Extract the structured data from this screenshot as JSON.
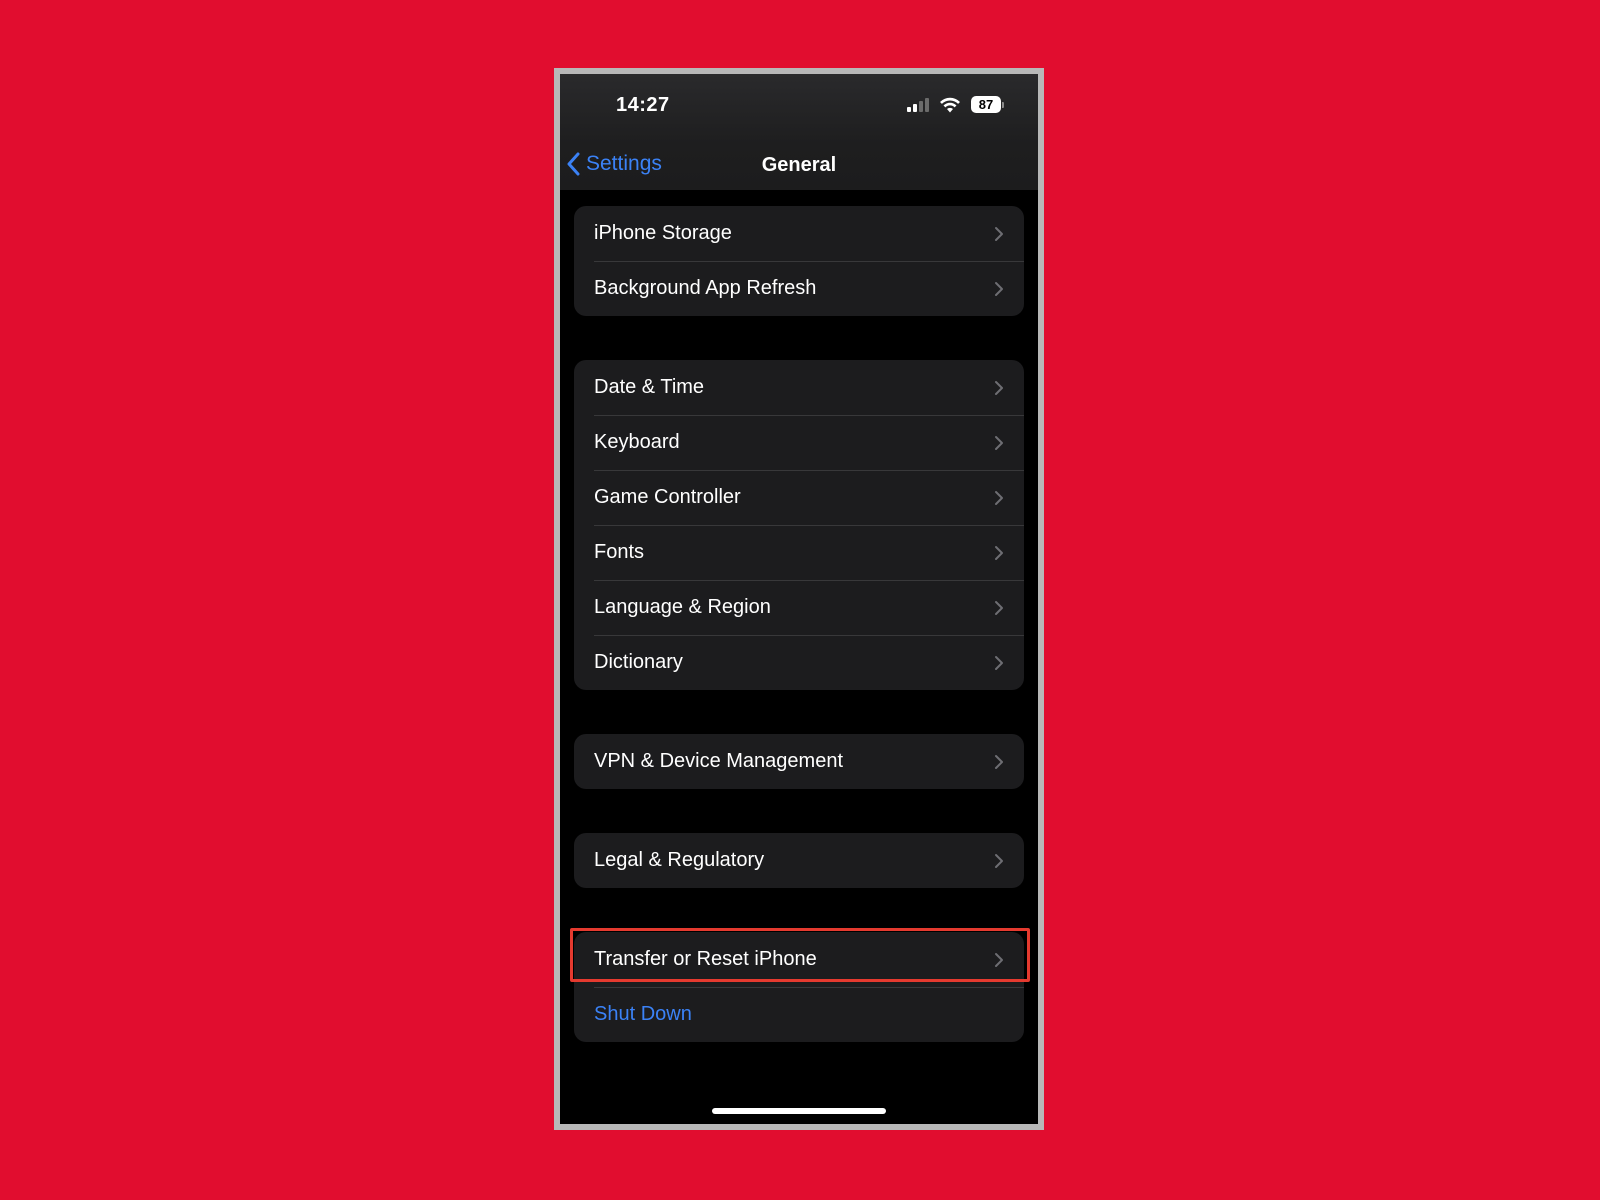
{
  "status_bar": {
    "time": "14:27",
    "battery_level": "87",
    "signal_bars_active": 2,
    "signal_bars_total": 4,
    "icons": [
      "signal-icon",
      "wifi-icon",
      "battery-icon"
    ]
  },
  "nav": {
    "back_label": "Settings",
    "title": "General"
  },
  "groups": [
    {
      "items": [
        {
          "label": "iPhone Storage"
        },
        {
          "label": "Background App Refresh"
        }
      ]
    },
    {
      "items": [
        {
          "label": "Date & Time"
        },
        {
          "label": "Keyboard"
        },
        {
          "label": "Game Controller"
        },
        {
          "label": "Fonts"
        },
        {
          "label": "Language & Region"
        },
        {
          "label": "Dictionary"
        }
      ]
    },
    {
      "items": [
        {
          "label": "VPN & Device Management"
        }
      ]
    },
    {
      "items": [
        {
          "label": "Legal & Regulatory"
        }
      ]
    },
    {
      "items": [
        {
          "label": "Transfer or Reset iPhone",
          "highlighted": true
        },
        {
          "label": "Shut Down",
          "style": "action"
        }
      ]
    }
  ],
  "colors": {
    "background": "#e10d2f",
    "accent": "#3b82f6",
    "highlight": "#e53a2f",
    "cell": "#1c1c1e"
  }
}
